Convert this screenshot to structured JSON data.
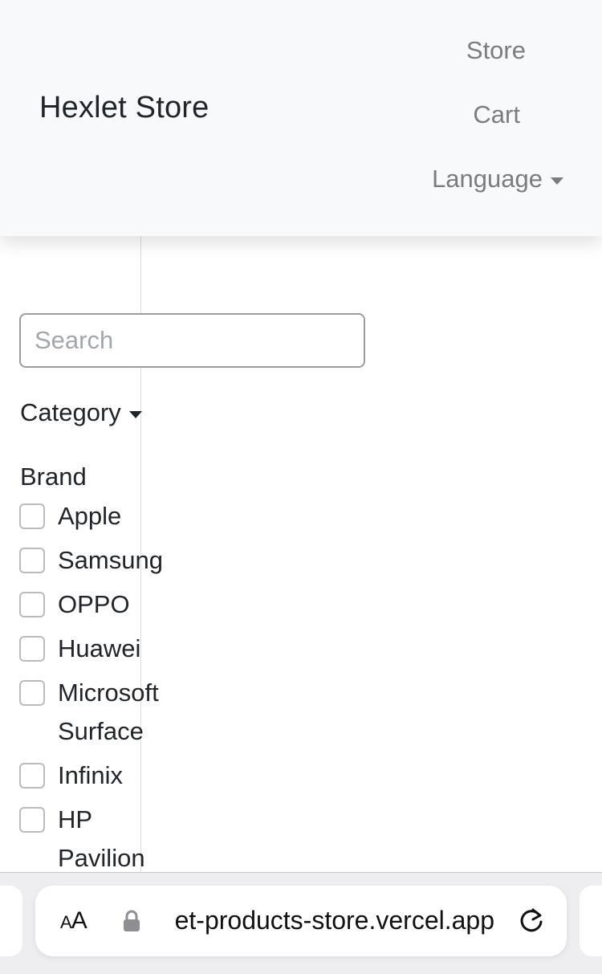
{
  "navbar": {
    "brand": "Hexlet Store",
    "links": {
      "store": "Store",
      "cart": "Cart",
      "language": "Language"
    }
  },
  "filters": {
    "search_placeholder": "Search",
    "search_value": "",
    "category_label": "Category",
    "brand_title": "Brand",
    "brands": [
      "Apple",
      "Samsung",
      "OPPO",
      "Huawei",
      "Microsoft Surface",
      "Infinix",
      "HP Pavilion"
    ]
  },
  "browser": {
    "text_size_label_small": "A",
    "text_size_label_large": "A",
    "url": "et-products-store.vercel.app",
    "icons": [
      "lock-icon",
      "reload-icon"
    ]
  }
}
